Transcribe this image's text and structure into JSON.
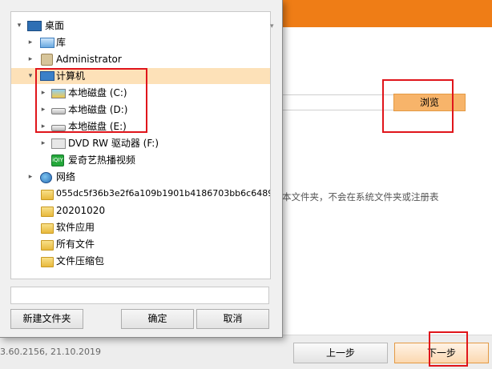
{
  "installer": {
    "browse_label": "浏览",
    "note_text": "本文件夹，不会在系统文件夹或注册表",
    "version_text": "3.60.2156, 21.10.2019",
    "prev_label": "上一步",
    "next_label": "下一步",
    "colors": {
      "header": "#ef7d16",
      "browse": "#f7b46a"
    }
  },
  "dialog": {
    "tree": [
      {
        "label": "桌面",
        "icon": "desktop-icon",
        "expander": "▾"
      },
      {
        "label": "库",
        "icon": "library-folder-icon",
        "expander": "▸"
      },
      {
        "label": "Administrator",
        "icon": "user-folder-icon",
        "expander": "▸"
      },
      {
        "label": "计算机",
        "icon": "computer-icon",
        "expander": "▾"
      },
      {
        "label": "本地磁盘 (C:)",
        "icon": "system-disk-icon",
        "expander": "▸"
      },
      {
        "label": "本地磁盘 (D:)",
        "icon": "hard-disk-icon",
        "expander": "▸"
      },
      {
        "label": "本地磁盘 (E:)",
        "icon": "hard-disk-icon",
        "expander": "▸"
      },
      {
        "label": "DVD RW 驱动器 (F:)",
        "icon": "dvd-drive-icon",
        "expander": "▸"
      },
      {
        "label": "爱奇艺热播视频",
        "icon": "iqiyi-icon",
        "expander": ""
      },
      {
        "label": "网络",
        "icon": "network-icon",
        "expander": "▸"
      },
      {
        "label": "055dc5f36b3e2f6a109b1901b4186703bb6c6489",
        "icon": "folder-icon",
        "expander": ""
      },
      {
        "label": "20201020",
        "icon": "folder-icon",
        "expander": ""
      },
      {
        "label": "软件应用",
        "icon": "folder-icon",
        "expander": ""
      },
      {
        "label": "所有文件",
        "icon": "folder-icon",
        "expander": ""
      },
      {
        "label": "文件压缩包",
        "icon": "folder-icon",
        "expander": ""
      }
    ],
    "iqiyi_badge": "iQIY",
    "folder_name_value": "",
    "new_folder_label": "新建文件夹",
    "ok_label": "确定",
    "cancel_label": "取消",
    "selected_color": "#fde1b8"
  }
}
